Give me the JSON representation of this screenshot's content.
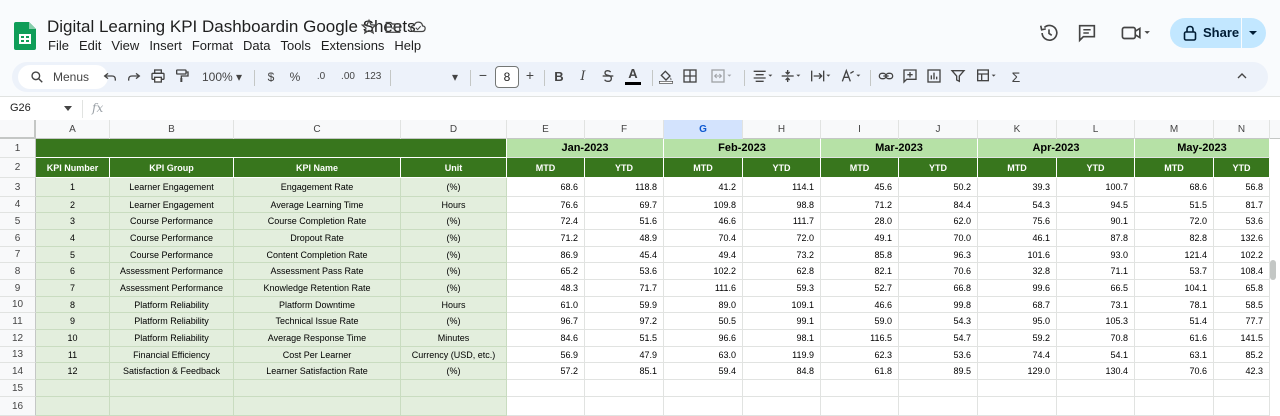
{
  "app": {
    "title": "Digital Learning KPI Dashboardin Google Sheets",
    "menu": [
      "File",
      "Edit",
      "View",
      "Insert",
      "Format",
      "Data",
      "Tools",
      "Extensions",
      "Help"
    ],
    "share_label": "Share"
  },
  "toolbar": {
    "menus_label": "Menus",
    "zoom": "100%",
    "currency": "$",
    "percent": "%",
    "dec_decrease": ".0",
    "dec_increase": ".00",
    "number_format": "123",
    "font_size": "8",
    "minus": "−",
    "plus": "+",
    "bold": "B",
    "italic": "I",
    "text_color": "A"
  },
  "formula_bar": {
    "cell_ref": "G26",
    "fx": "fx",
    "value": ""
  },
  "columns": [
    "A",
    "B",
    "C",
    "D",
    "E",
    "F",
    "G",
    "H",
    "I",
    "J",
    "K",
    "L",
    "M",
    "N"
  ],
  "selected_column": "G",
  "row_numbers": [
    "1",
    "2",
    "3",
    "4",
    "5",
    "6",
    "7",
    "8",
    "9",
    "10",
    "11",
    "12",
    "13",
    "14",
    "15",
    "16"
  ],
  "headers": {
    "kpi_number": "KPI Number",
    "kpi_group": "KPI Group",
    "kpi_name": "KPI Name",
    "unit": "Unit",
    "mtd": "MTD",
    "ytd": "YTD"
  },
  "months": [
    "Jan-2023",
    "Feb-2023",
    "Mar-2023",
    "Apr-2023",
    "May-2023"
  ],
  "kpis": [
    {
      "num": "1",
      "group": "Learner Engagement",
      "name": "Engagement Rate",
      "unit": "(%)",
      "values": [
        "68.6",
        "118.8",
        "41.2",
        "114.1",
        "45.6",
        "50.2",
        "39.3",
        "100.7",
        "68.6",
        "56.8"
      ]
    },
    {
      "num": "2",
      "group": "Learner Engagement",
      "name": "Average Learning Time",
      "unit": "Hours",
      "values": [
        "76.6",
        "69.7",
        "109.8",
        "98.8",
        "71.2",
        "84.4",
        "54.3",
        "94.5",
        "51.5",
        "81.7"
      ]
    },
    {
      "num": "3",
      "group": "Course Performance",
      "name": "Course Completion Rate",
      "unit": "(%)",
      "values": [
        "72.4",
        "51.6",
        "46.6",
        "111.7",
        "28.0",
        "62.0",
        "75.6",
        "90.1",
        "72.0",
        "53.6"
      ]
    },
    {
      "num": "4",
      "group": "Course Performance",
      "name": "Dropout Rate",
      "unit": "(%)",
      "values": [
        "71.2",
        "48.9",
        "70.4",
        "72.0",
        "49.1",
        "70.0",
        "46.1",
        "87.8",
        "82.8",
        "132.6"
      ]
    },
    {
      "num": "5",
      "group": "Course Performance",
      "name": "Content Completion Rate",
      "unit": "(%)",
      "values": [
        "86.9",
        "45.4",
        "49.4",
        "73.2",
        "85.8",
        "96.3",
        "101.6",
        "93.0",
        "121.4",
        "102.2"
      ]
    },
    {
      "num": "6",
      "group": "Assessment Performance",
      "name": "Assessment Pass Rate",
      "unit": "(%)",
      "values": [
        "65.2",
        "53.6",
        "102.2",
        "62.8",
        "82.1",
        "70.6",
        "32.8",
        "71.1",
        "53.7",
        "108.4"
      ]
    },
    {
      "num": "7",
      "group": "Assessment Performance",
      "name": "Knowledge Retention Rate",
      "unit": "(%)",
      "values": [
        "48.3",
        "71.7",
        "111.6",
        "59.3",
        "52.7",
        "66.8",
        "99.6",
        "66.5",
        "104.1",
        "65.8"
      ]
    },
    {
      "num": "8",
      "group": "Platform Reliability",
      "name": "Platform Downtime",
      "unit": "Hours",
      "values": [
        "61.0",
        "59.9",
        "89.0",
        "109.1",
        "46.6",
        "99.8",
        "68.7",
        "73.1",
        "78.1",
        "58.5"
      ]
    },
    {
      "num": "9",
      "group": "Platform Reliability",
      "name": "Technical Issue Rate",
      "unit": "(%)",
      "values": [
        "96.7",
        "97.2",
        "50.5",
        "99.1",
        "59.0",
        "54.3",
        "95.0",
        "105.3",
        "51.4",
        "77.7"
      ]
    },
    {
      "num": "10",
      "group": "Platform Reliability",
      "name": "Average Response Time",
      "unit": "Minutes",
      "values": [
        "84.6",
        "51.5",
        "96.6",
        "98.1",
        "116.5",
        "54.7",
        "59.2",
        "70.8",
        "61.6",
        "141.5"
      ]
    },
    {
      "num": "11",
      "group": "Financial Efficiency",
      "name": "Cost Per Learner",
      "unit": "Currency (USD, etc.)",
      "values": [
        "56.9",
        "47.9",
        "63.0",
        "119.9",
        "62.3",
        "53.6",
        "74.4",
        "54.1",
        "63.1",
        "85.2"
      ]
    },
    {
      "num": "12",
      "group": "Satisfaction & Feedback",
      "name": "Learner Satisfaction Rate",
      "unit": "(%)",
      "values": [
        "57.2",
        "85.1",
        "59.4",
        "84.8",
        "61.8",
        "89.5",
        "129.0",
        "130.4",
        "70.6",
        "42.3"
      ]
    }
  ]
}
